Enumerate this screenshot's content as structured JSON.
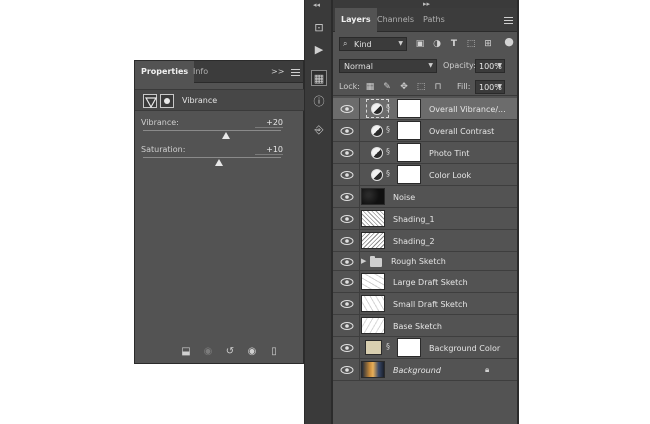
{
  "properties": {
    "tabs": [
      {
        "label": "Properties",
        "active": true
      },
      {
        "label": "Info",
        "active": false
      }
    ],
    "menu_glyph": ">>",
    "adjustment_title": "Vibrance",
    "sliders": [
      {
        "label": "Vibrance:",
        "value": "+20",
        "position_pct": 60
      },
      {
        "label": "Saturation:",
        "value": "+10",
        "position_pct": 55
      }
    ],
    "footer_icons": [
      "clip-to-layer-icon",
      "view-previous-icon",
      "reset-icon",
      "visibility-eye-icon",
      "delete-icon"
    ]
  },
  "strip": {
    "collapse_glyph": "◂◂",
    "tools": [
      "history-icon",
      "actions-play-icon",
      "navigator-icon",
      "info-icon",
      "clone-source-icon"
    ]
  },
  "layers": {
    "collapse_glyph": "▸▸",
    "tabs": [
      {
        "label": "Layers",
        "active": true
      },
      {
        "label": "Channels",
        "active": false
      },
      {
        "label": "Paths",
        "active": false
      }
    ],
    "filter": {
      "label": "Kind"
    },
    "blend_mode": "Normal",
    "opacity_label": "Opacity:",
    "opacity_value": "100%",
    "lock_label": "Lock:",
    "fill_label": "Fill:",
    "fill_value": "100%",
    "items": [
      {
        "name": "Overall Vibrance/...",
        "kind": "adjustment",
        "selected": true
      },
      {
        "name": "Overall Contrast",
        "kind": "adjustment"
      },
      {
        "name": "Photo Tint",
        "kind": "adjustment"
      },
      {
        "name": "Color Look",
        "kind": "adjustment"
      },
      {
        "name": "Noise",
        "kind": "pixel",
        "thumb": "noise"
      },
      {
        "name": "Shading_1",
        "kind": "pixel",
        "thumb": "sketch-dense"
      },
      {
        "name": "Shading_2",
        "kind": "pixel",
        "thumb": "sketch-dense"
      },
      {
        "name": "Rough Sketch",
        "kind": "group"
      },
      {
        "name": "Large Draft Sketch",
        "kind": "pixel",
        "thumb": "sketch-light"
      },
      {
        "name": "Small Draft Sketch",
        "kind": "pixel",
        "thumb": "sketch-light"
      },
      {
        "name": "Base Sketch",
        "kind": "pixel",
        "thumb": "sketch-light"
      },
      {
        "name": "Background Color",
        "kind": "fill",
        "color": "#d9cfb0"
      },
      {
        "name": "Background",
        "kind": "background",
        "locked": true
      }
    ]
  },
  "colors": {
    "panel": "#535353",
    "tabbar": "#3c3c3c",
    "selected_row": "#6c6c6c"
  }
}
